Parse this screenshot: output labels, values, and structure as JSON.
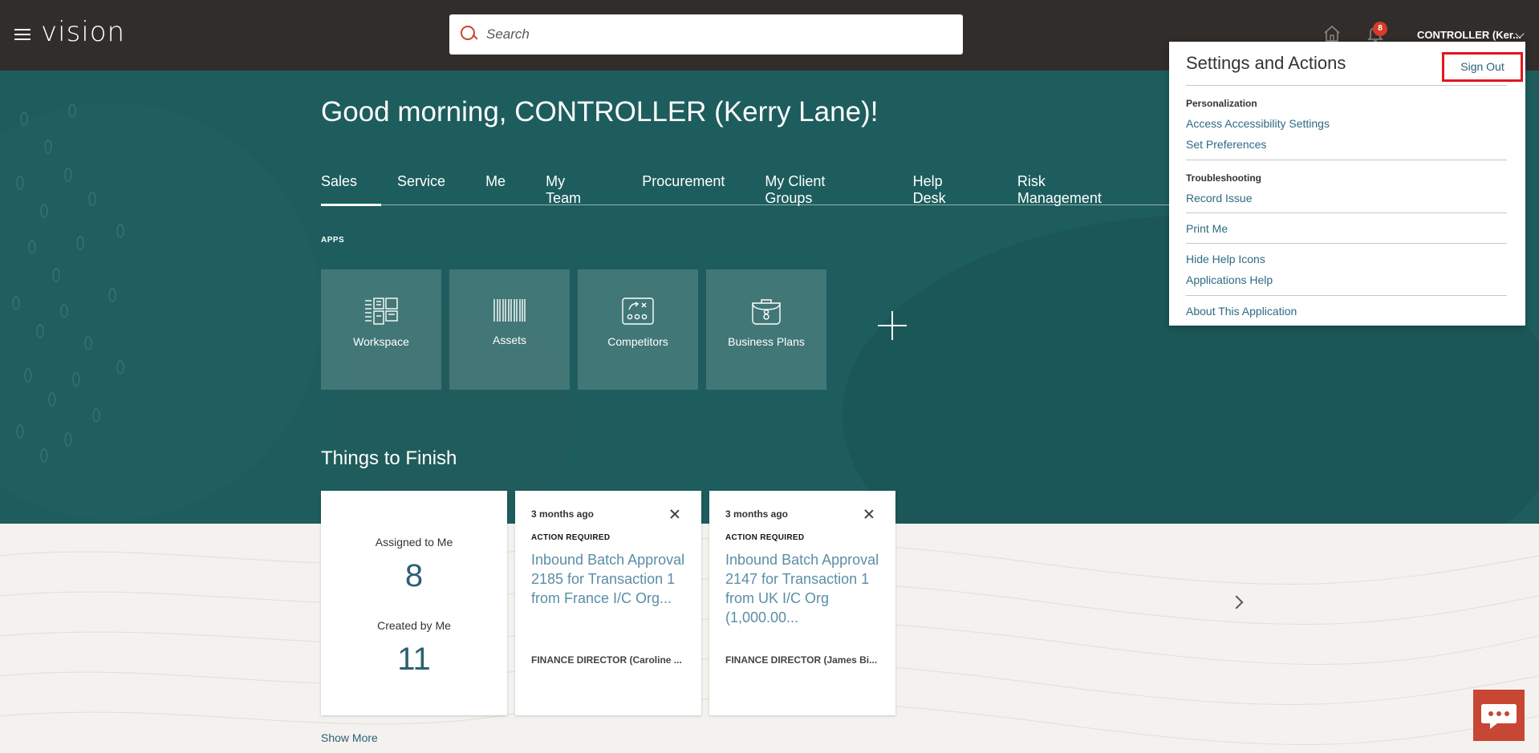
{
  "header": {
    "logo": "vision",
    "search_placeholder": "Search",
    "notifications_count": "8",
    "user_label": "CONTROLLER (Ker..."
  },
  "hero": {
    "greeting": "Good morning, CONTROLLER (Kerry Lane)!",
    "tabs": [
      {
        "label": "Sales"
      },
      {
        "label": "Service"
      },
      {
        "label": "Me"
      },
      {
        "label": "My Team"
      },
      {
        "label": "Procurement"
      },
      {
        "label": "My Client Groups"
      },
      {
        "label": "Help Desk"
      },
      {
        "label": "Risk Management"
      }
    ],
    "apps_label": "APPS",
    "apps": [
      {
        "label": "Workspace",
        "icon": "workspace-icon"
      },
      {
        "label": "Assets",
        "icon": "barcode-icon"
      },
      {
        "label": "Competitors",
        "icon": "competitors-icon"
      },
      {
        "label": "Business Plans",
        "icon": "briefcase-icon"
      }
    ],
    "things_title": "Things to Finish"
  },
  "things": {
    "summary": {
      "assigned_label": "Assigned to Me",
      "assigned_count": "8",
      "created_label": "Created by Me",
      "created_count": "11"
    },
    "cards": [
      {
        "time": "3 months ago",
        "status": "ACTION REQUIRED",
        "description": "Inbound Batch Approval 2185 for Transaction 1 from France I/C Org...",
        "from": "FINANCE DIRECTOR (Caroline ..."
      },
      {
        "time": "3 months ago",
        "status": "ACTION REQUIRED",
        "description": "Inbound Batch Approval 2147 for Transaction 1 from UK I/C Org (1,000.00...",
        "from": "FINANCE DIRECTOR (James Bi..."
      }
    ],
    "show_more": "Show More"
  },
  "settings_panel": {
    "title": "Settings and Actions",
    "sign_out": "Sign Out",
    "personalization_header": "Personalization",
    "access_accessibility": "Access Accessibility Settings",
    "set_preferences": "Set Preferences",
    "troubleshooting_header": "Troubleshooting",
    "record_issue": "Record Issue",
    "print_me": "Print Me",
    "hide_help_icons": "Hide Help Icons",
    "applications_help": "Applications Help",
    "about": "About This Application"
  },
  "colors": {
    "topbar": "#312d2a",
    "hero": "#1e5d5d",
    "accent_red": "#c74634",
    "highlight": "#e5141e",
    "link": "#2c6b84"
  }
}
